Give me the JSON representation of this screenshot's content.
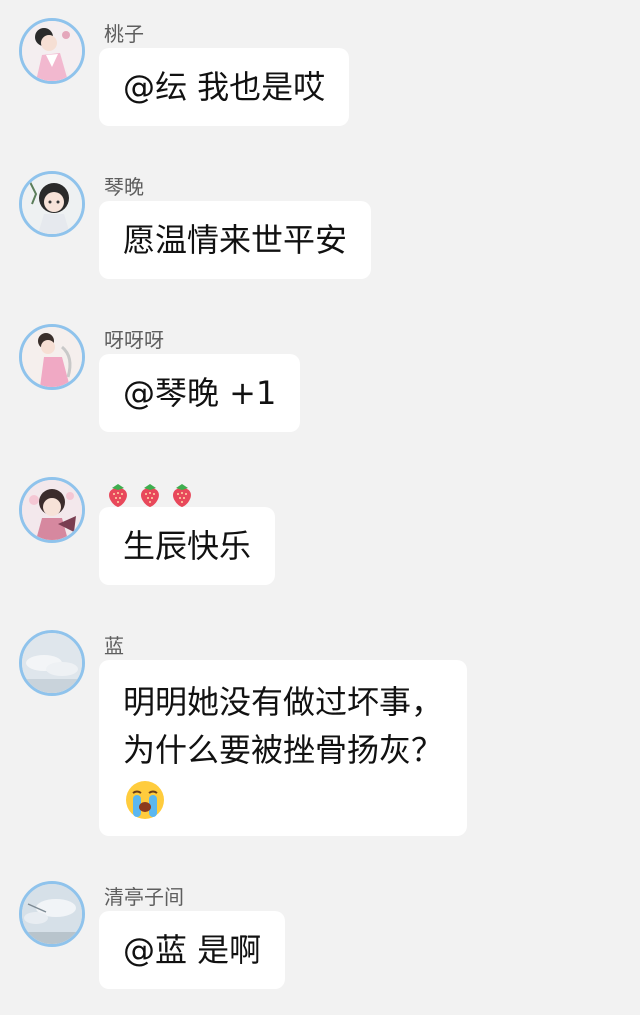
{
  "messages": [
    {
      "name": "桃子",
      "text": "@纭 我也是哎"
    },
    {
      "name": "琴晚",
      "text": "愿温情来世平安"
    },
    {
      "name": "呀呀呀",
      "text": "@琴晚  +1"
    },
    {
      "name_icons": [
        "strawberry-icon",
        "strawberry-icon",
        "strawberry-icon"
      ],
      "text": "生辰快乐"
    },
    {
      "name": "蓝",
      "lines": [
        "明明她没有做过坏事，",
        "为什么要被挫骨扬灰？"
      ],
      "emoji": "loudly-crying-face-icon"
    },
    {
      "name": "清亭子间",
      "text": "@蓝 是啊"
    }
  ],
  "colors": {
    "background": "#f2f2f2",
    "bubble": "#ffffff",
    "avatar_ring": "#8fc3ec",
    "name_text": "#5e5e5e",
    "message_text": "#111111"
  }
}
